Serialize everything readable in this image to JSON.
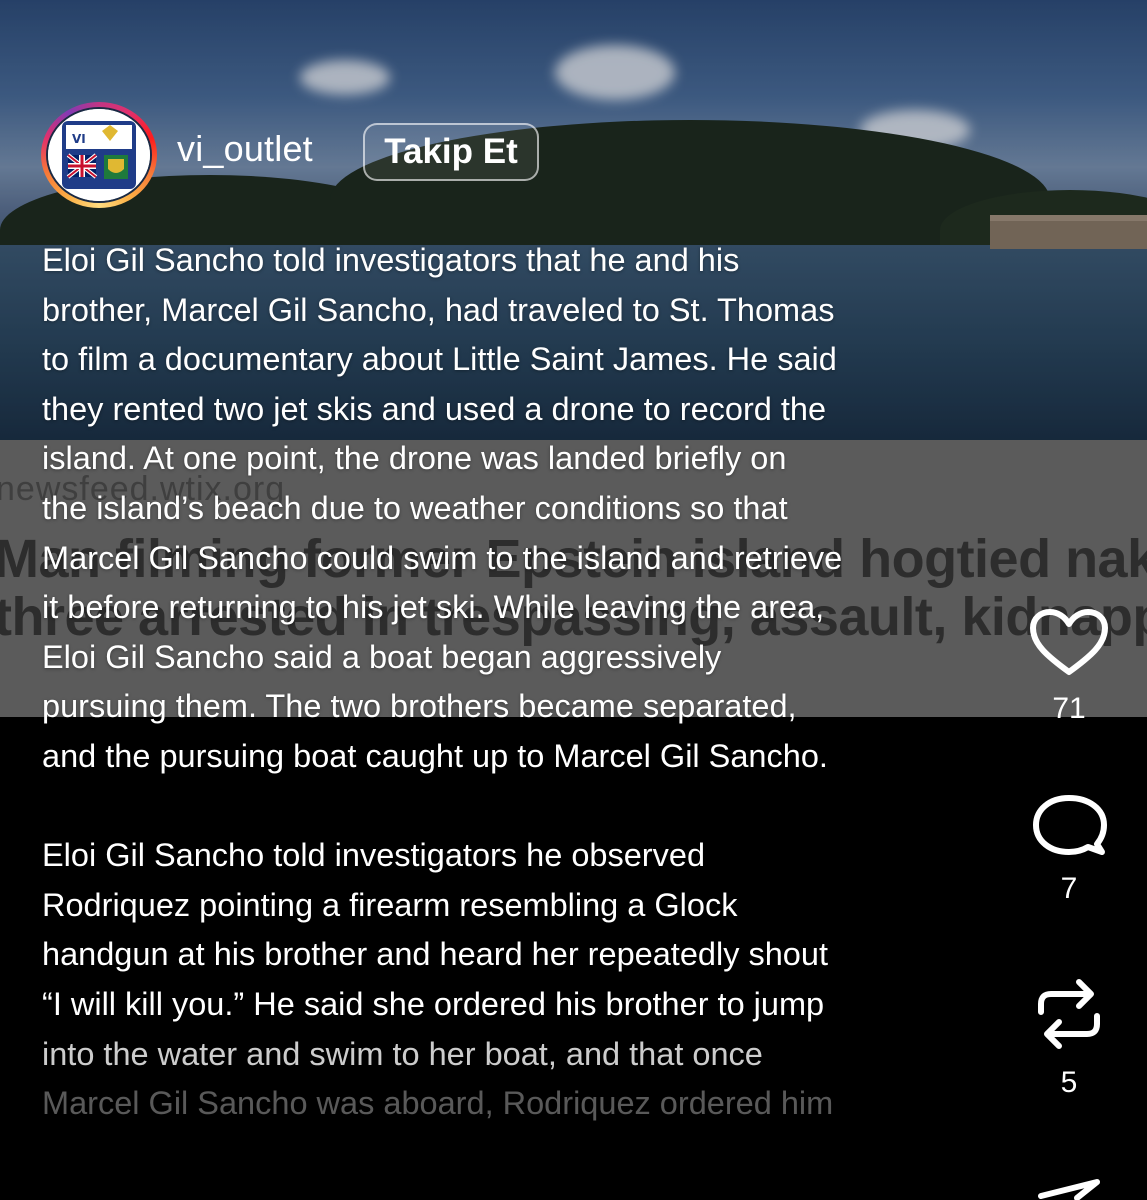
{
  "post": {
    "username": "vi_outlet",
    "follow_label": "Takip Et"
  },
  "embed": {
    "source": "newsfeed.wtix.org",
    "headline_lines": [
      "Man filming former Epstein island hogtied naked;",
      "three arrested in trespassing, assault, kidnapping"
    ]
  },
  "caption": {
    "paragraphs": [
      [
        "Eloi Gil Sancho told investigators that he and his",
        "brother, Marcel Gil Sancho, had traveled to St. Thomas",
        "to film a documentary about Little Saint James. He said",
        "they rented two jet skis and used a drone to record the",
        "island. At one point, the drone was landed briefly on",
        "the island’s beach due to weather conditions so that",
        "Marcel Gil Sancho could swim to the island and retrieve",
        "it before returning to his jet ski. While leaving the area,",
        "Eloi Gil Sancho said a boat began aggressively",
        "pursuing them. The two brothers became separated,",
        "and the pursuing boat caught up to Marcel Gil Sancho."
      ],
      [
        "Eloi Gil Sancho told investigators he observed",
        "Rodriquez pointing a firearm resembling a Glock",
        "handgun at his brother and heard her repeatedly shout",
        "“I will kill you.” He said she ordered his brother to jump",
        "into the water and swim to her boat, and that once",
        "Marcel Gil Sancho was aboard, Rodriquez ordered him"
      ]
    ]
  },
  "actions": {
    "like": {
      "icon": "heart-icon",
      "count": "71"
    },
    "comment": {
      "icon": "comment-icon",
      "count": "7"
    },
    "repost": {
      "icon": "repost-icon",
      "count": "5"
    },
    "share": {
      "icon": "share-icon"
    }
  },
  "colors": {
    "text": "#ffffff",
    "background": "#000000",
    "embed_band": "#5b5b5b"
  }
}
